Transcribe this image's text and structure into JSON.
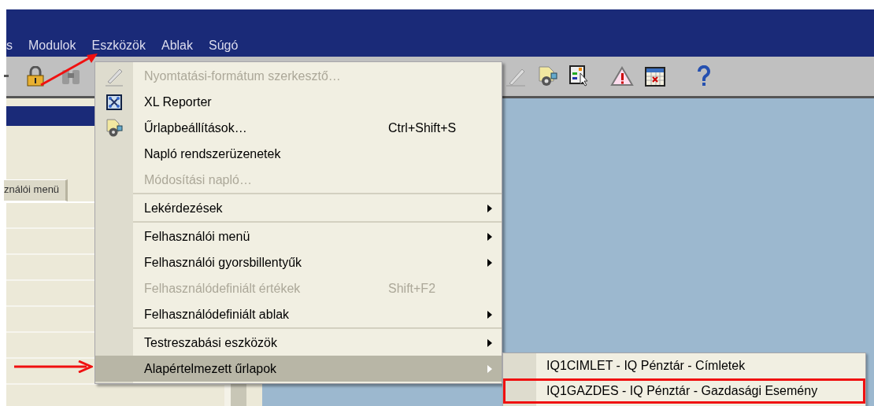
{
  "menubar": [
    {
      "label": "s"
    },
    {
      "label": "Modulok"
    },
    {
      "label": "Eszközök"
    },
    {
      "label": "Ablak"
    },
    {
      "label": "Súgó"
    }
  ],
  "left_panel": {
    "tab": {
      "label": "ználói menü"
    }
  },
  "menu": {
    "items": [
      {
        "kind": "item",
        "label": "Nyomtatási-formátum szerkesztő…",
        "disabled": true,
        "submenu": false,
        "selected": false
      },
      {
        "kind": "item",
        "label": "XL Reporter",
        "disabled": false,
        "submenu": false,
        "selected": false
      },
      {
        "kind": "item",
        "label": "Űrlapbeállítások…",
        "shortcut": "Ctrl+Shift+S",
        "disabled": false,
        "submenu": false,
        "selected": false
      },
      {
        "kind": "item",
        "label": "Napló rendszerüzenetek",
        "disabled": false,
        "submenu": false,
        "selected": false
      },
      {
        "kind": "item",
        "label": "Módosítási napló…",
        "disabled": true,
        "submenu": false,
        "selected": false
      },
      {
        "kind": "separator"
      },
      {
        "kind": "item",
        "label": "Lekérdezések",
        "disabled": false,
        "submenu": true,
        "selected": false
      },
      {
        "kind": "separator"
      },
      {
        "kind": "item",
        "label": "Felhasználói menü",
        "disabled": false,
        "submenu": true,
        "selected": false
      },
      {
        "kind": "item",
        "label": "Felhasználói gyorsbillentyűk",
        "disabled": false,
        "submenu": true,
        "selected": false
      },
      {
        "kind": "item",
        "label": "Felhasználódefiniált értékek",
        "shortcut": "Shift+F2",
        "disabled": true,
        "submenu": false,
        "selected": false
      },
      {
        "kind": "item",
        "label": "Felhasználódefiniált ablak",
        "disabled": false,
        "submenu": true,
        "selected": false
      },
      {
        "kind": "separator"
      },
      {
        "kind": "item",
        "label": "Testreszabási eszközök",
        "disabled": false,
        "submenu": true,
        "selected": false
      },
      {
        "kind": "item",
        "label": "Alapértelmezett űrlapok",
        "disabled": false,
        "submenu": true,
        "selected": true
      }
    ]
  },
  "submenu": {
    "items": [
      {
        "label": "IQ1CIMLET - IQ Pénztár - Címletek",
        "marked": false
      },
      {
        "label": "IQ1GAZDES - IQ Pénztár - Gazdasági Esemény",
        "marked": true
      }
    ]
  }
}
